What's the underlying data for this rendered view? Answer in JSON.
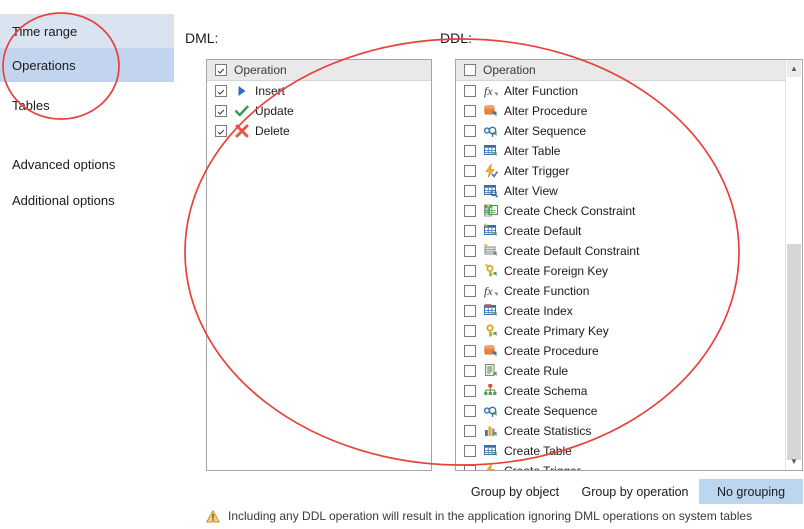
{
  "sidebar": {
    "items": [
      {
        "label": "Time range",
        "state": "hover"
      },
      {
        "label": "Operations",
        "state": "selected"
      },
      {
        "label": "Tables",
        "state": "normal"
      }
    ],
    "links": [
      {
        "label": "Advanced options"
      },
      {
        "label": "Additional options"
      }
    ]
  },
  "dml": {
    "label": "DML:",
    "header": {
      "label": "Operation",
      "checked": true
    },
    "rows": [
      {
        "label": "Insert",
        "checked": true,
        "icon": "insert-arrow-icon"
      },
      {
        "label": "Update",
        "checked": true,
        "icon": "update-check-icon"
      },
      {
        "label": "Delete",
        "checked": true,
        "icon": "delete-cross-icon"
      }
    ]
  },
  "ddl": {
    "label": "DDL:",
    "header": {
      "label": "Operation",
      "checked": false
    },
    "rows": [
      {
        "label": "Alter Function",
        "checked": false,
        "icon": "function-icon"
      },
      {
        "label": "Alter Procedure",
        "checked": false,
        "icon": "procedure-icon"
      },
      {
        "label": "Alter Sequence",
        "checked": false,
        "icon": "sequence-icon"
      },
      {
        "label": "Alter Table",
        "checked": false,
        "icon": "table-icon"
      },
      {
        "label": "Alter Trigger",
        "checked": false,
        "icon": "trigger-icon"
      },
      {
        "label": "Alter View",
        "checked": false,
        "icon": "view-icon"
      },
      {
        "label": "Create Check Constraint",
        "checked": false,
        "icon": "check-constraint-icon"
      },
      {
        "label": "Create Default",
        "checked": false,
        "icon": "default-icon"
      },
      {
        "label": "Create Default Constraint",
        "checked": false,
        "icon": "default-constraint-icon"
      },
      {
        "label": "Create Foreign Key",
        "checked": false,
        "icon": "foreign-key-icon"
      },
      {
        "label": "Create Function",
        "checked": false,
        "icon": "function-icon"
      },
      {
        "label": "Create Index",
        "checked": false,
        "icon": "index-icon"
      },
      {
        "label": "Create Primary Key",
        "checked": false,
        "icon": "primary-key-icon"
      },
      {
        "label": "Create Procedure",
        "checked": false,
        "icon": "procedure-icon"
      },
      {
        "label": "Create Rule",
        "checked": false,
        "icon": "rule-icon"
      },
      {
        "label": "Create Schema",
        "checked": false,
        "icon": "schema-icon"
      },
      {
        "label": "Create Sequence",
        "checked": false,
        "icon": "sequence-icon"
      },
      {
        "label": "Create Statistics",
        "checked": false,
        "icon": "statistics-icon"
      },
      {
        "label": "Create Table",
        "checked": false,
        "icon": "table-icon"
      },
      {
        "label": "Create Trigger",
        "checked": false,
        "icon": "trigger-icon"
      }
    ],
    "scrollbar": {
      "up_arrow": "▲",
      "down_arrow": "▼"
    }
  },
  "grouping": {
    "buttons": [
      {
        "label": "Group by object",
        "active": false
      },
      {
        "label": "Group by operation",
        "active": false
      },
      {
        "label": "No grouping",
        "active": true
      }
    ]
  },
  "footer": {
    "warning_icon": "warning-triangle-icon",
    "text": "Including any DDL operation will result in the application ignoring DML operations on system tables"
  },
  "annotation": {
    "color": "#e8413c",
    "shapes": [
      "ellipse-sidebar-operations",
      "ellipse-operation-lists"
    ]
  }
}
